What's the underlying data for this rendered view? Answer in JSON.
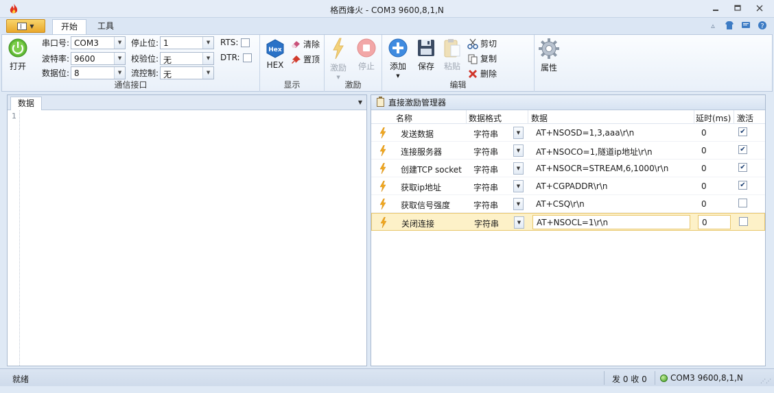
{
  "window": {
    "title": "格西烽火 - COM3  9600,8,1,N",
    "minimize": "▭",
    "restore": "◻",
    "close": "✕"
  },
  "ribbon_tabs": [
    {
      "label": "开始",
      "active": true
    },
    {
      "label": "工具",
      "active": false
    }
  ],
  "ribbon": {
    "comm": {
      "open_label": "打开",
      "port_label": "串口号:",
      "port_value": "COM3",
      "baud_label": "波特率:",
      "baud_value": "9600",
      "databits_label": "数据位:",
      "databits_value": "8",
      "stopbits_label": "停止位:",
      "stopbits_value": "1",
      "parity_label": "校验位:",
      "parity_value": "无",
      "flow_label": "流控制:",
      "flow_value": "无",
      "rts_label": "RTS:",
      "dtr_label": "DTR:",
      "group_label": "通信接口"
    },
    "display": {
      "hex_icon_text": "Hex",
      "hex_label": "HEX",
      "clear_label": "清除",
      "top_label": "置顶",
      "group_label": "显示"
    },
    "stimulus": {
      "stim_label": "激励",
      "stop_label": "停止",
      "group_label": "激励"
    },
    "edit": {
      "add_label": "添加",
      "save_label": "保存",
      "paste_label": "粘贴",
      "cut_label": "剪切",
      "copy_label": "复制",
      "delete_label": "删除",
      "group_label": "编辑"
    },
    "props": {
      "props_label": "属性"
    }
  },
  "left_pane": {
    "tab_label": "数据",
    "menu_glyph": "▼",
    "line_number": "1"
  },
  "right_pane": {
    "title": "直接激励管理器",
    "columns": {
      "name": "名称",
      "format": "数据格式",
      "data": "数据",
      "delay": "延时(ms)",
      "active": "激活"
    },
    "rows": [
      {
        "name": "发送数据",
        "format": "字符串",
        "data": "AT+NSOSD=1,3,aaa\\r\\n",
        "delay": "0",
        "active": true
      },
      {
        "name": "连接服务器",
        "format": "字符串",
        "data": "AT+NSOCO=1,隧道ip地址\\r\\n",
        "delay": "0",
        "active": true
      },
      {
        "name": "创建TCP socket",
        "format": "字符串",
        "data": "AT+NSOCR=STREAM,6,1000\\r\\n",
        "delay": "0",
        "active": true
      },
      {
        "name": "获取ip地址",
        "format": "字符串",
        "data": "AT+CGPADDR\\r\\n",
        "delay": "0",
        "active": true
      },
      {
        "name": "获取信号强度",
        "format": "字符串",
        "data": "AT+CSQ\\r\\n",
        "delay": "0",
        "active": false
      },
      {
        "name": "关闭连接",
        "format": "字符串",
        "data": "AT+NSOCL=1\\r\\n",
        "delay": "0",
        "active": false
      }
    ]
  },
  "statusbar": {
    "ready": "就绪",
    "counts": "发 0  收 0",
    "port": "COM3  9600,8,1,N"
  },
  "colors": {
    "ribbon_bg": "#e9f0f9",
    "selected_row": "#fdf1c8",
    "accent_blue": "#2e6fb5"
  }
}
